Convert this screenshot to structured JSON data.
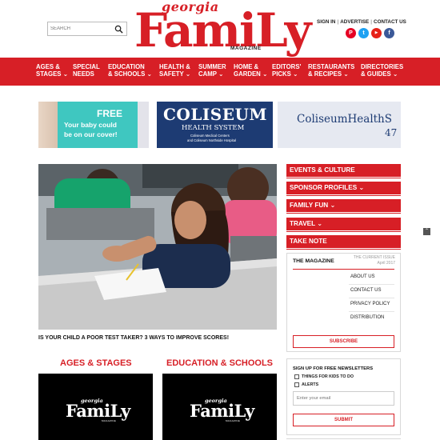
{
  "header": {
    "search_placeholder": "SEARCH",
    "logo": {
      "georgia": "georgia",
      "family": "FamiLy",
      "magazine": "MAGAZINE"
    },
    "top_links": [
      "SIGN IN",
      "ADVERTISE",
      "CONTACT US"
    ],
    "social": [
      {
        "icon": "pinterest-icon",
        "glyph": "P",
        "color": "#e60023"
      },
      {
        "icon": "twitter-icon",
        "glyph": "t",
        "color": "#1da1f2"
      },
      {
        "icon": "youtube-icon",
        "glyph": "▶",
        "color": "#e62117"
      },
      {
        "icon": "facebook-icon",
        "glyph": "f",
        "color": "#3b5998"
      }
    ]
  },
  "nav": {
    "items": [
      {
        "label_1": "AGES &",
        "label_2": "STAGES ⌄"
      },
      {
        "label_1": "SPECIAL",
        "label_2": "NEEDS"
      },
      {
        "label_1": "EDUCATION",
        "label_2": "& SCHOOLS ⌄"
      },
      {
        "label_1": "HEALTH &",
        "label_2": "SAFETY ⌄"
      },
      {
        "label_1": "SUMMER",
        "label_2": "CAMP ⌄"
      },
      {
        "label_1": "HOME &",
        "label_2": "GARDEN ⌄"
      },
      {
        "label_1": "EDITORS'",
        "label_2": "PICKS ⌄"
      },
      {
        "label_1": "RESTAURANTS",
        "label_2": "& RECIPES ⌄"
      },
      {
        "label_1": "DIRECTORIES",
        "label_2": "& GUIDES ⌄"
      }
    ]
  },
  "banner": {
    "ad1": {
      "free": "FREE",
      "line1": "Your baby could",
      "line2": "be on our cover!"
    },
    "ad2": {
      "title": "COLISEUM",
      "subtitle": "HEALTH SYSTEM",
      "sub1": "Coliseum Medical Centers",
      "sub2": "and Coliseum Northside Hospital"
    },
    "ad3": {
      "title": "ColiseumHealthS",
      "number": "47"
    }
  },
  "hero": {
    "caption": "IS YOUR CHILD A POOR TEST TAKER? 3 WAYS TO IMPROVE SCORES!"
  },
  "sections": [
    {
      "title": "AGES & STAGES"
    },
    {
      "title": "EDUCATION & SCHOOLS"
    }
  ],
  "card_logo": {
    "georgia": "georgia",
    "family": "FamiLy",
    "magazine": "MAGAZINE"
  },
  "sidebar": {
    "buttons": [
      "EVENTS & CULTURE",
      "SPONSOR PROFILES ⌄",
      "FAMILY FUN ⌄",
      "TRAVEL ⌄",
      "TAKE NOTE"
    ],
    "magazine": {
      "title": "THE MAGAZINE",
      "issue_label": "THE CURRENT ISSUE",
      "issue_date": "April 2017",
      "links": [
        "ABOUT US",
        "CONTACT US",
        "PRIVACY POLICY",
        "DISTRIBUTION"
      ],
      "subscribe": "SUBSCRIBE"
    },
    "newsletter": {
      "title": "SIGN UP FOR FREE NEWSLETTERS",
      "options": [
        "THINGS FOR KIDS TO DO",
        "ALERTS"
      ],
      "email_placeholder": "Enter your email",
      "submit": "SUBMIT"
    }
  },
  "colors": {
    "brand_red": "#d71f26",
    "navy": "#1d3b73",
    "teal": "#3fc7c0"
  }
}
